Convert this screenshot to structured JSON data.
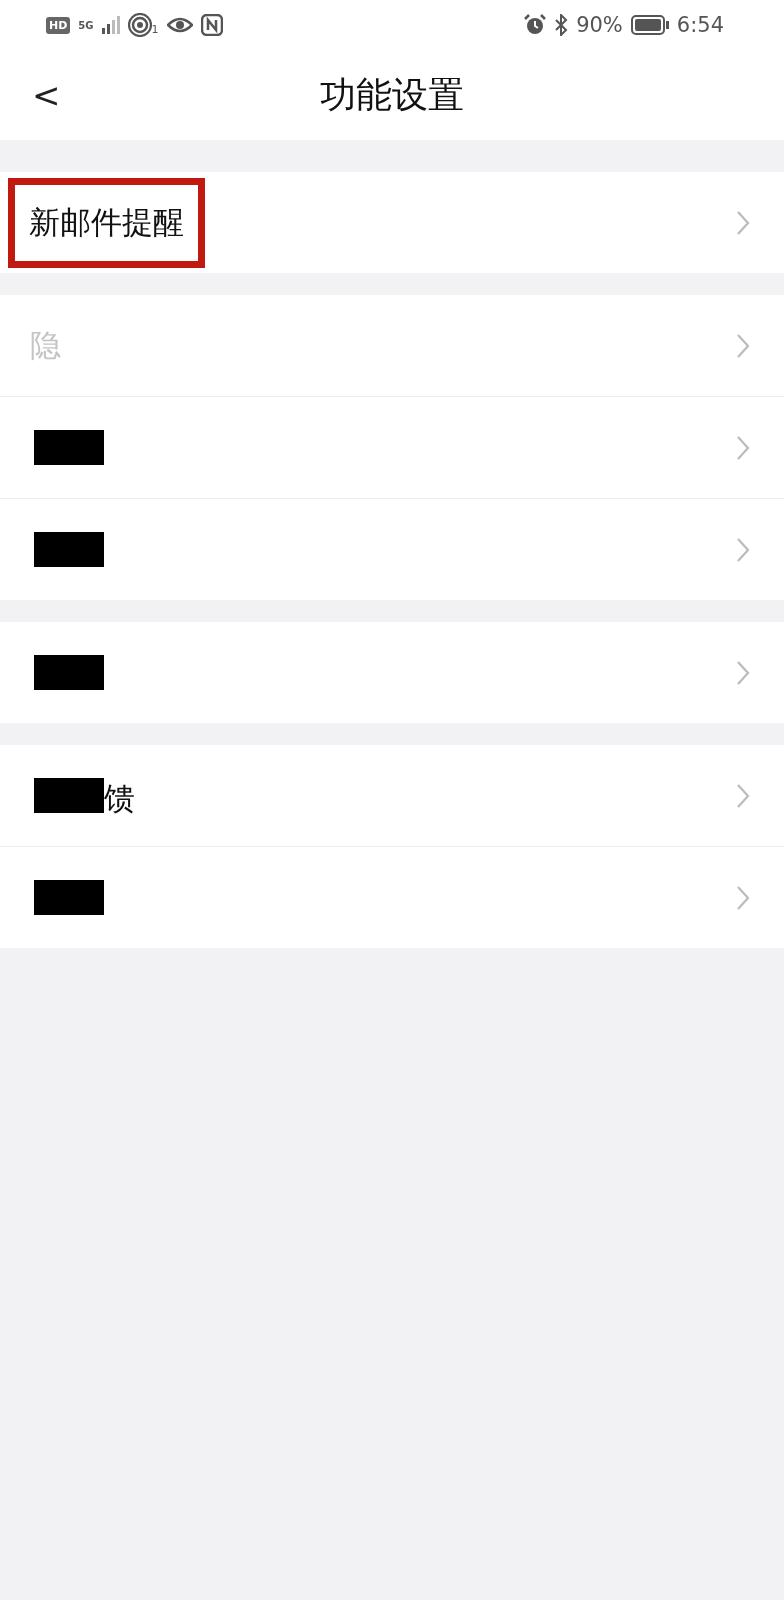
{
  "status_bar": {
    "hd": "HD",
    "network": "5G",
    "hotspot_count": "1",
    "battery": "90%",
    "time": "6:54"
  },
  "header": {
    "back": "<",
    "title": "功能设置"
  },
  "groups": [
    {
      "items": [
        {
          "label": "新邮件提醒",
          "highlighted": true,
          "redacted": false,
          "faded": false
        }
      ]
    },
    {
      "items": [
        {
          "label": "隐",
          "highlighted": false,
          "redacted": false,
          "faded": true
        },
        {
          "redacted": true
        },
        {
          "redacted": true
        }
      ]
    },
    {
      "items": [
        {
          "redacted": true
        }
      ]
    },
    {
      "items": [
        {
          "label": "馈",
          "highlighted": false,
          "redacted": true,
          "faded": false
        },
        {
          "redacted": true
        }
      ]
    }
  ]
}
